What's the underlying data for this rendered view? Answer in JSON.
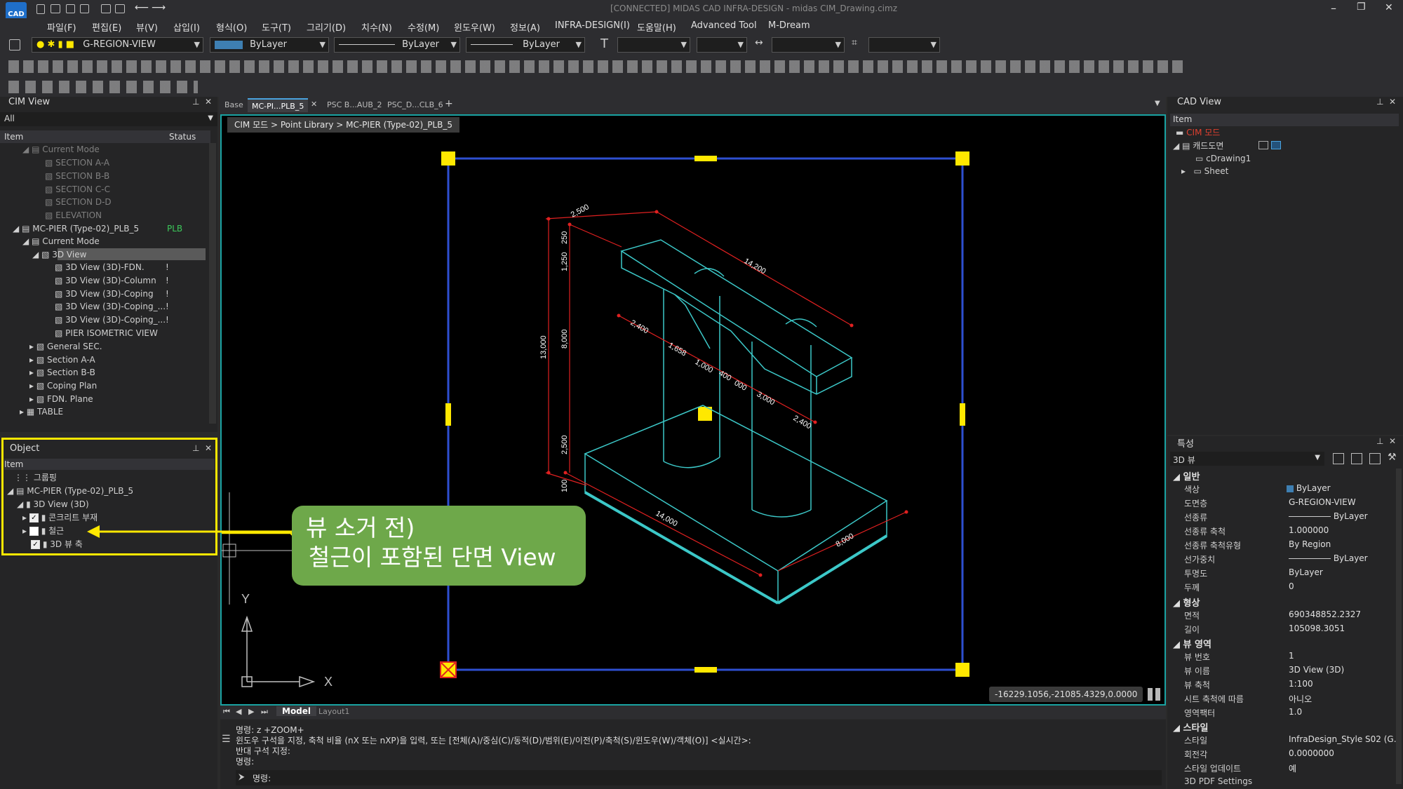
{
  "app": {
    "logo": "CAD",
    "title": "[CONNECTED] MIDAS CAD INFRA-DESIGN - midas CIM_Drawing.cimz",
    "win_min": "–",
    "win_max": "❐",
    "win_close": "✕"
  },
  "menu": [
    "파일(F)",
    "편집(E)",
    "뷰(V)",
    "삽입(I)",
    "형식(O)",
    "도구(T)",
    "그리기(D)",
    "치수(N)",
    "수정(M)",
    "윈도우(W)",
    "정보(A)",
    "INFRA-DESIGN(I)",
    "도움말(H)",
    "Advanced Tool",
    "M-Dream"
  ],
  "toolbar": {
    "layer": "G-REGION-VIEW",
    "color": "ByLayer",
    "linetype": "ByLayer",
    "lineweight": "ByLayer"
  },
  "cim_view": {
    "title": "CIM View",
    "filter": "All",
    "col_item": "Item",
    "col_status": "Status",
    "rows": [
      {
        "label": "Current Mode",
        "dim": true
      },
      {
        "label": "SECTION A-A",
        "dim": true
      },
      {
        "label": "SECTION B-B",
        "dim": true
      },
      {
        "label": "SECTION C-C",
        "dim": true
      },
      {
        "label": "SECTION D-D",
        "dim": true
      },
      {
        "label": "ELEVATION",
        "dim": true
      },
      {
        "label": "MC-PIER (Type-02)_PLB_5",
        "status": "PLB"
      },
      {
        "label": "Current Mode"
      },
      {
        "label": "3D View",
        "selected": true
      },
      {
        "label": "3D View (3D)-FDN.",
        "status": "!"
      },
      {
        "label": "3D View (3D)-Column",
        "status": "!"
      },
      {
        "label": "3D View (3D)-Coping",
        "status": "!"
      },
      {
        "label": "3D View (3D)-Coping_...",
        "status": "!"
      },
      {
        "label": "3D View (3D)-Coping_...",
        "status": "!"
      },
      {
        "label": "PIER ISOMETRIC VIEW"
      },
      {
        "label": "General SEC."
      },
      {
        "label": "Section A-A"
      },
      {
        "label": "Section B-B"
      },
      {
        "label": "Coping Plan"
      },
      {
        "label": "FDN. Plane"
      },
      {
        "label": "TABLE"
      }
    ]
  },
  "object_panel": {
    "title": "Object",
    "col_item": "Item",
    "rows": [
      {
        "label": "그룹핑"
      },
      {
        "label": "MC-PIER (Type-02)_PLB_5"
      },
      {
        "label": "3D View (3D)"
      },
      {
        "label": "콘크리트 부재",
        "checked": true
      },
      {
        "label": "철근",
        "checked": false
      },
      {
        "label": "3D 뷰 축",
        "checked": true
      }
    ]
  },
  "doc_tabs": [
    "Base",
    "MC-PI...PLB_5",
    "PSC B...AUB_2",
    "PSC_D...CLB_6"
  ],
  "breadcrumb": "CIM 모드 > Point Library > MC-PIER (Type-02)_PLB_5",
  "drawing": {
    "dims": [
      "2,500",
      "1,250",
      "250",
      "14,200",
      "13,000",
      "8,000",
      "2,400",
      "1,658",
      "1,000",
      "400",
      "000",
      "3,000",
      "2,400",
      "2,500",
      "100",
      "14,000",
      "8,000"
    ],
    "axis_y": "Y",
    "axis_x": "X"
  },
  "callout": {
    "line1": "뷰 소거 전)",
    "line2": "철근이 포함된 단면 View"
  },
  "coords": "-16229.1056,-21085.4329,0.0000",
  "layout_tabs": [
    "Model",
    "Layout1"
  ],
  "command": {
    "lines": [
      "명령: z +ZOOM+",
      "윈도우 구석을 지정, 축척 비율 (nX 또는 nXP)을 입력, 또는 [전체(A)/중심(C)/동적(D)/범위(E)/이전(P)/축척(S)/윈도우(W)/객체(O)] <실시간>:",
      "반대 구석 지정:",
      "명령:"
    ],
    "prompt": "명령:"
  },
  "cad_view": {
    "title": "CAD View",
    "col_item": "Item",
    "rows": [
      "CIM 모드",
      "캐드도면",
      "cDrawing1",
      "Sheet"
    ]
  },
  "properties": {
    "title": "특성",
    "selector": "3D 뷰",
    "sections": [
      {
        "name": "일반",
        "items": [
          [
            "색상",
            "ByLayer"
          ],
          [
            "도면층",
            "G-REGION-VIEW"
          ],
          [
            "선종류",
            "ByLayer"
          ],
          [
            "선종류 축척",
            "1.000000"
          ],
          [
            "선종류 축척유형",
            "By Region"
          ],
          [
            "선가중치",
            "ByLayer"
          ],
          [
            "투명도",
            "ByLayer"
          ],
          [
            "두께",
            "0"
          ]
        ]
      },
      {
        "name": "형상",
        "items": [
          [
            "면적",
            "690348852.2327"
          ],
          [
            "길이",
            "105098.3051"
          ]
        ]
      },
      {
        "name": "뷰 영역",
        "items": [
          [
            "뷰 번호",
            "1"
          ],
          [
            "뷰 이름",
            "3D View (3D)"
          ],
          [
            "뷰 축척",
            "1:100"
          ],
          [
            "시트 축척에 따름",
            "아니오"
          ],
          [
            "영역팩터",
            "1.0"
          ]
        ]
      },
      {
        "name": "스타일",
        "items": [
          [
            "스타일",
            "InfraDesign_Style S02 (G..."
          ],
          [
            "회전각",
            "0.0000000"
          ],
          [
            "스타일 업데이트",
            "예"
          ],
          [
            "3D PDF Settings",
            ""
          ]
        ]
      }
    ]
  },
  "colors": {
    "accent": "#ffe800",
    "callout": "#6ea84a",
    "cyan": "#3cc8c8",
    "red": "#e02020",
    "frame": "#2e4fd0"
  }
}
